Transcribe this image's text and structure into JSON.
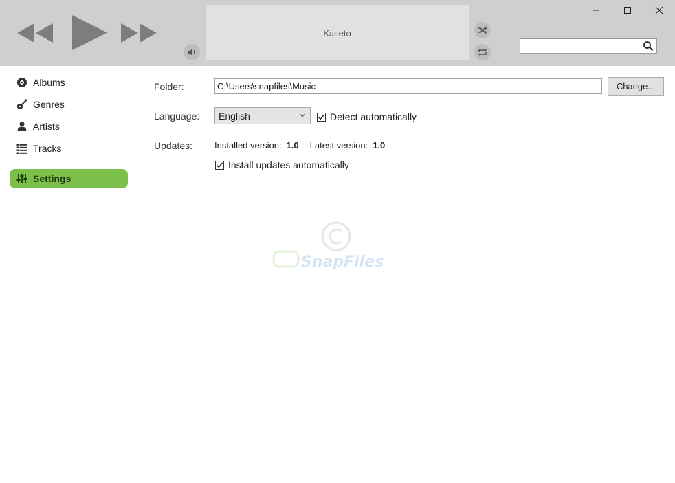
{
  "player": {
    "now_playing": "Kaseto"
  },
  "search": {
    "value": "",
    "placeholder": ""
  },
  "sidebar": {
    "items": [
      {
        "label": "Albums",
        "icon": "disc-icon"
      },
      {
        "label": "Genres",
        "icon": "guitar-icon"
      },
      {
        "label": "Artists",
        "icon": "person-icon"
      },
      {
        "label": "Tracks",
        "icon": "list-icon"
      },
      {
        "label": "Settings",
        "icon": "sliders-icon",
        "active": true
      }
    ]
  },
  "settings": {
    "folder_label": "Folder:",
    "folder_value": "C:\\Users\\snapfiles\\Music",
    "change_label": "Change...",
    "language_label": "Language:",
    "language_value": "English",
    "detect_label": "Detect automatically",
    "detect_checked": true,
    "updates_label": "Updates:",
    "installed_label": "Installed version:",
    "installed_value": "1.0",
    "latest_label": "Latest version:",
    "latest_value": "1.0",
    "auto_update_label": "Install updates automatically",
    "auto_update_checked": true
  },
  "watermark": {
    "text": "SnapFiles"
  },
  "colors": {
    "accent": "#7cc04b",
    "topbar": "#cfcfcf",
    "now_playing_bg": "#e1e1e1",
    "icon_gray": "#7a7a7a"
  }
}
